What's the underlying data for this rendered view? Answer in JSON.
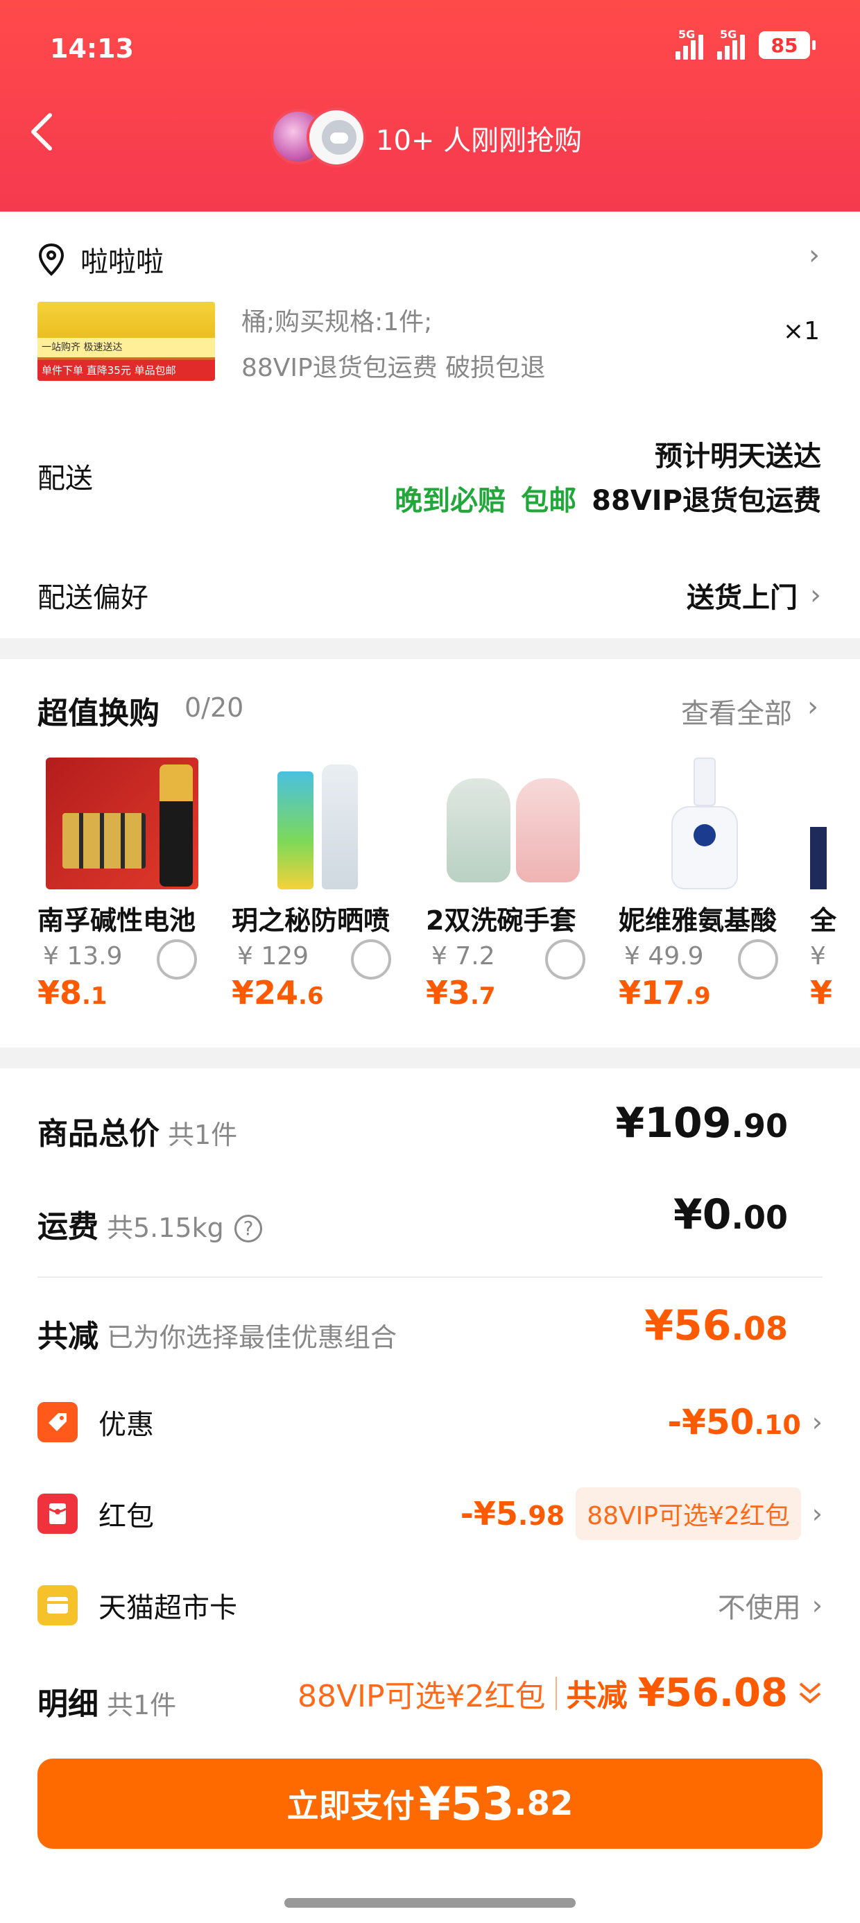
{
  "status_bar": {
    "time": "14:13",
    "signal1": "5G",
    "signal2": "5G",
    "battery": "85"
  },
  "header": {
    "title": "10+ 人刚刚抢购"
  },
  "address": {
    "name": "啦啦啦"
  },
  "product": {
    "spec": "桶;购买规格:1件;",
    "tags": "88VIP退货包运费  破损包退",
    "qty": "×1",
    "thumb_text_1": "一站购齐 极速送达",
    "thumb_text_2": "单件下单 直降35元  单品包邮"
  },
  "delivery": {
    "label": "配送",
    "eta": "预计明天送达",
    "tag_late": "晚到必赔",
    "tag_free": "包邮",
    "tag_vip": "88VIP退货包运费"
  },
  "delivery_pref": {
    "label": "配送偏好",
    "value": "送货上门"
  },
  "exchange": {
    "title": "超值换购",
    "count": "0/20",
    "view_all": "查看全部",
    "items": [
      {
        "name": "南孚碱性电池",
        "old_price": "¥ 13.9",
        "new_int": "¥8",
        "new_dec": ".1"
      },
      {
        "name": "玥之秘防晒喷",
        "old_price": "¥ 129",
        "new_int": "¥24",
        "new_dec": ".6"
      },
      {
        "name": "2双洗碗手套",
        "old_price": "¥ 7.2",
        "new_int": "¥3",
        "new_dec": ".7"
      },
      {
        "name": "妮维雅氨基酸",
        "old_price": "¥ 49.9",
        "new_int": "¥17",
        "new_dec": ".9"
      },
      {
        "name": "全",
        "old_price": "¥",
        "new_int": "¥",
        "new_dec": ""
      }
    ]
  },
  "totals": {
    "goods_label": "商品总价",
    "goods_sub": "共1件",
    "goods_int": "¥109",
    "goods_dec": ".90",
    "ship_label": "运费",
    "ship_sub": "共5.15kg",
    "ship_int": "¥0",
    "ship_dec": ".00",
    "reduce_label": "共减",
    "reduce_sub": "已为你选择最佳优惠组合",
    "reduce_int": "¥56",
    "reduce_dec": ".08"
  },
  "discounts": {
    "promo_label": "优惠",
    "promo_int": "-¥50",
    "promo_dec": ".10",
    "redpack_label": "红包",
    "redpack_int": "-¥5",
    "redpack_dec": ".98",
    "redpack_pill": "88VIP可选¥2红包",
    "card_label": "天猫超市卡",
    "card_value": "不使用"
  },
  "detail": {
    "label": "明细",
    "sub": "共1件",
    "pill": "88VIP可选¥2红包",
    "total_prefix": "共减 ",
    "total": "¥56.08"
  },
  "pay": {
    "label": "立即支付",
    "int": "¥53",
    "dec": ".82"
  },
  "colors": {
    "header": "#f53a4f",
    "accent": "#ff5a00",
    "green": "#22a83a"
  }
}
